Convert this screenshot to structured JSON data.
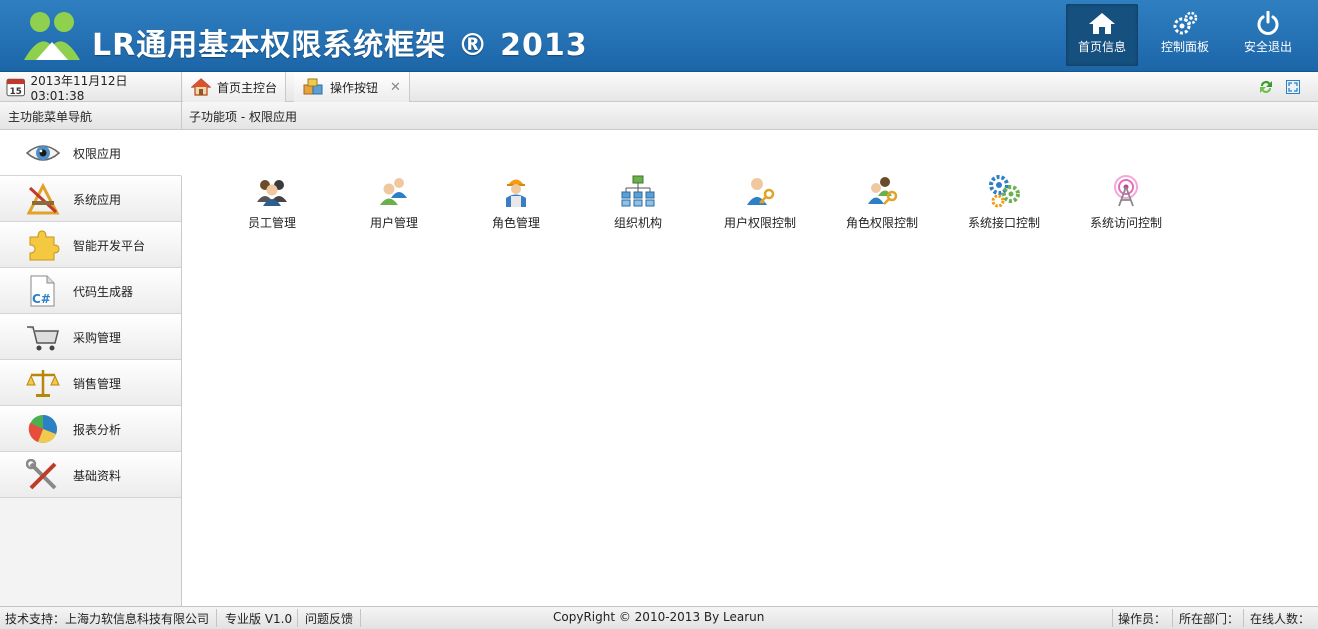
{
  "header": {
    "title": "LR通用基本权限系统框架 ® 2013",
    "buttons": [
      {
        "label": "首页信息",
        "icon": "home-icon",
        "active": true
      },
      {
        "label": "控制面板",
        "icon": "gears-icon",
        "active": false
      },
      {
        "label": "安全退出",
        "icon": "power-icon",
        "active": false
      }
    ],
    "colors": {
      "bar": "#1f6db0",
      "active": "#15507f"
    }
  },
  "tabbar": {
    "datetime": "2013年11月12日 03:01:38",
    "calendar_day": "15",
    "tabs": [
      {
        "label": "首页主控台",
        "closable": false
      },
      {
        "label": "操作按钮",
        "closable": true
      }
    ],
    "close_glyph": "✕"
  },
  "sidebar": {
    "heading": "主功能菜单导航",
    "items": [
      {
        "label": "权限应用",
        "icon": "eye-icon",
        "active": true
      },
      {
        "label": "系统应用",
        "icon": "tools-icon",
        "active": false
      },
      {
        "label": "智能开发平台",
        "icon": "puzzle-icon",
        "active": false
      },
      {
        "label": "代码生成器",
        "icon": "csharp-file-icon",
        "active": false
      },
      {
        "label": "采购管理",
        "icon": "cart-icon",
        "active": false
      },
      {
        "label": "销售管理",
        "icon": "scale-icon",
        "active": false
      },
      {
        "label": "报表分析",
        "icon": "pie-chart-icon",
        "active": false
      },
      {
        "label": "基础资料",
        "icon": "wrench-icon",
        "active": false
      }
    ]
  },
  "main": {
    "heading": "子功能项 - 权限应用",
    "apps": [
      {
        "label": "员工管理",
        "icon": "employees-icon"
      },
      {
        "label": "用户管理",
        "icon": "users-icon"
      },
      {
        "label": "角色管理",
        "icon": "worker-icon"
      },
      {
        "label": "组织机构",
        "icon": "org-chart-icon"
      },
      {
        "label": "用户权限控制",
        "icon": "user-key-icon"
      },
      {
        "label": "角色权限控制",
        "icon": "role-key-icon"
      },
      {
        "label": "系统接口控制",
        "icon": "colored-gears-icon"
      },
      {
        "label": "系统访问控制",
        "icon": "antenna-icon"
      }
    ]
  },
  "footer": {
    "support": "技术支持：上海力软信息科技有限公司",
    "edition": "专业版 V1.0",
    "feedback": "问题反馈",
    "copyright": "CopyRight © 2010-2013 By Learun",
    "operator": "操作员：",
    "department": "所在部门：",
    "online": "在线人数："
  }
}
